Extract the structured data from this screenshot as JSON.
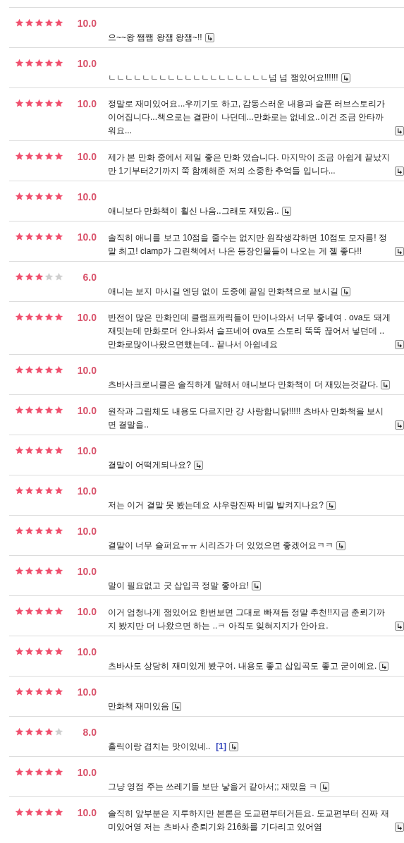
{
  "reviews": [
    {
      "stars": 5,
      "score": "10.0",
      "text": "으~~왕 쨈쨈 왕잼 왕잼~!!"
    },
    {
      "stars": 5,
      "score": "10.0",
      "text": "ㄴㄴㄴㄴㄴㄴㄴㄴㄴㄴㄴㄴㄴㄴㄴㄴㄴㄴㄴ넘 넘 잼있어요!!!!!!"
    },
    {
      "stars": 5,
      "score": "10.0",
      "text": "정말로 재미있어요...우끼기도 하고, 감동스러운 내용과 슬픈 러브스토리가 이어집니다...책으로는 결판이 나던데...만화로는 없네요..이건 조금 안타까워요..."
    },
    {
      "stars": 5,
      "score": "10.0",
      "text": "제가 본 만화 중에서 제일 좋은 만화 였습니다. 마지막이 조금 아쉽게 끝났지만 1기부터2기까지 쭉 함께해준 저의 소중한 추억들 입니다..."
    },
    {
      "stars": 5,
      "score": "10.0",
      "text": "애니보다 만화책이 휠신 나음..그래도 재밌음.."
    },
    {
      "stars": 5,
      "score": "10.0",
      "text": "솔직히 애니를 보고 10점을 줄수는 없지만 원작생각하면 10점도 모자름! 정말 최고! clamp가 그린책에서 나온 등장인물들이 나오는 게 젤 좋다!!"
    },
    {
      "stars": 3,
      "score": "6.0",
      "text": "애니는 보지 마시길 엔딩 없이 도중에 끝임 만화책으로 보시길"
    },
    {
      "stars": 5,
      "score": "10.0",
      "text": "반전이 많은 만화인데 클램프캐릭들이 만이나와서 너무 좋네여 . ova도 돼게 재밋는데 만화로더 안나와서 슬프네여 ova도 스토리 뚝뚝 끊어서 넣던데 .. 만화로많이나왔으면했는데.. 끝나서 아쉽네요"
    },
    {
      "stars": 5,
      "score": "10.0",
      "text": "츠바사크로니클은 솔직하게 말해서 애니보다 만화책이 더 재밌는것같다."
    },
    {
      "stars": 5,
      "score": "10.0",
      "text": "원작과 그림체도 내용도 다르지만 걍 사랑합니닭!!!!! 츠바사 만화책을 보시면 결말을.."
    },
    {
      "stars": 5,
      "score": "10.0",
      "text": "결말이 어떡게되나요?"
    },
    {
      "stars": 5,
      "score": "10.0",
      "text": "저는 이거 결말 못 봤는데요 샤우랑진짜 비밀 발켜지나요?"
    },
    {
      "stars": 5,
      "score": "10.0",
      "text": "결말이 너무 슬퍼요ㅠㅠ 시리즈가 더 있었으면 좋겠어요ㅋㅋ"
    },
    {
      "stars": 5,
      "score": "10.0",
      "text": "말이 필요없고 굿 삽입곡 정말 좋아요!"
    },
    {
      "stars": 5,
      "score": "10.0",
      "text": "이거 엄청나게 잼있어요 한번보면 그대로 빠져듬 정말 추천!!지금 춘뢰기까지 봤지만 더 나왔으면 하는 ..ㅋ 아직도 잊혀지지가 안아요."
    },
    {
      "stars": 5,
      "score": "10.0",
      "text": "츠바사도 상당히 재미있게 봤구여. 내용도 좋고 삽입곡도 좋고 굳이예요."
    },
    {
      "stars": 5,
      "score": "10.0",
      "text": "만화책 재미있음"
    },
    {
      "stars": 4,
      "score": "8.0",
      "text": "홀릭이랑 겹치는 맛이있네..",
      "comment_count": "[1]"
    },
    {
      "stars": 5,
      "score": "10.0",
      "text": "그냥 영점 주는 쓰레기들 보단 낳을거 같아서;; 재밌음 ㅋ"
    },
    {
      "stars": 5,
      "score": "10.0",
      "text": "솔직히 앞부분은 지루하지만 본론은 도교편부터거든요. 도교편부터 진짜 재미있어영 저는 츠바사 춘뢰기와 216화를 기다리고 있어염"
    }
  ]
}
